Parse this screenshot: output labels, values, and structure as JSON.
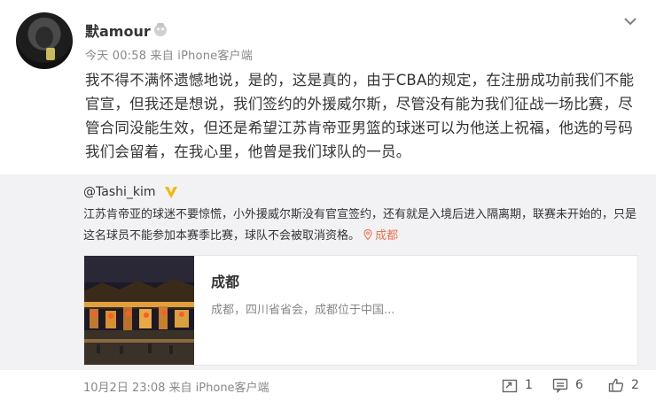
{
  "post": {
    "username": "默amour",
    "meta": "今天 00:58 来自 iPhone客户端",
    "content": "我不得不满怀遗憾地说，是的，这是真的，由于CBA的规定，在注册成功前我们不能官宣，但我还是想说，我们签约的外援威尔斯，尽管没有能为我们征战一场比赛，尽管合同没能生效，但还是希望江苏肯帝亚男篮的球迷可以为他送上祝福，他选的号码我们会留着，在我心里，他曾是我们球队的一员。"
  },
  "repost": {
    "author": "@Tashi_kim",
    "text": "江苏肯帝亚的球迷不要惊慌，小外援威尔斯没有官宣签约，还有就是入境后进入隔离期，联赛未开始的，只是这名球员不能参加本赛季比赛，球队不会被取消资格。",
    "location": "成都",
    "card": {
      "title": "成都",
      "desc": "成都，四川省省会，成都位于中国..."
    },
    "date": "10月2日 23:08 来自 iPhone客户端",
    "reposts": "1",
    "comments": "6",
    "likes": "2"
  },
  "colors": {
    "accent_orange": "#eb7350",
    "vip_gold": "#f7b500",
    "repost_bg": "#f2f2f5",
    "muted_text": "#888888"
  },
  "icons": [
    "user-badge-icon",
    "chevron-down-icon",
    "vip-badge-icon",
    "location-pin-icon",
    "repost-icon",
    "comment-icon",
    "like-icon"
  ]
}
